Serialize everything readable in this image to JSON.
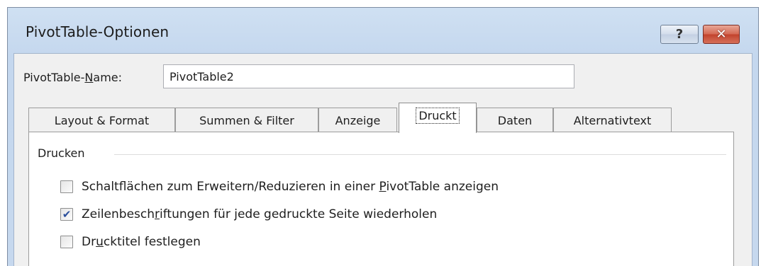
{
  "window": {
    "title": "PivotTable-Optionen",
    "help_glyph": "?",
    "close_glyph": "✕"
  },
  "name_field": {
    "label_pre": "PivotTable-",
    "label_mnemonic": "N",
    "label_post": "ame:",
    "value": "PivotTable2"
  },
  "tabs": [
    {
      "label": "Layout & Format",
      "active": false
    },
    {
      "label": "Summen & Filter",
      "active": false
    },
    {
      "label": "Anzeige",
      "active": false
    },
    {
      "label": "Druckt",
      "active": true
    },
    {
      "label": "Daten",
      "active": false
    },
    {
      "label": "Alternativtext",
      "active": false
    }
  ],
  "group": {
    "title": "Drucken",
    "options": [
      {
        "pre": "Schaltflächen zum Erweitern/Reduzieren in einer ",
        "mnemonic": "P",
        "post": "ivotTable anzeigen",
        "checked": false
      },
      {
        "pre": "Zeilenbesch",
        "mnemonic": "r",
        "post": "iftungen für jede gedruckte Seite wiederholen",
        "checked": true
      },
      {
        "pre": "Dr",
        "mnemonic": "u",
        "post": "cktitel festlegen",
        "checked": false
      }
    ]
  },
  "icons": {
    "checkmark": "✔"
  },
  "colors": {
    "title_bar": "#c4d7ee",
    "close_button": "#c2432d",
    "dialog_bg": "#f0f0f0",
    "checkmark": "#2b4f9c"
  }
}
